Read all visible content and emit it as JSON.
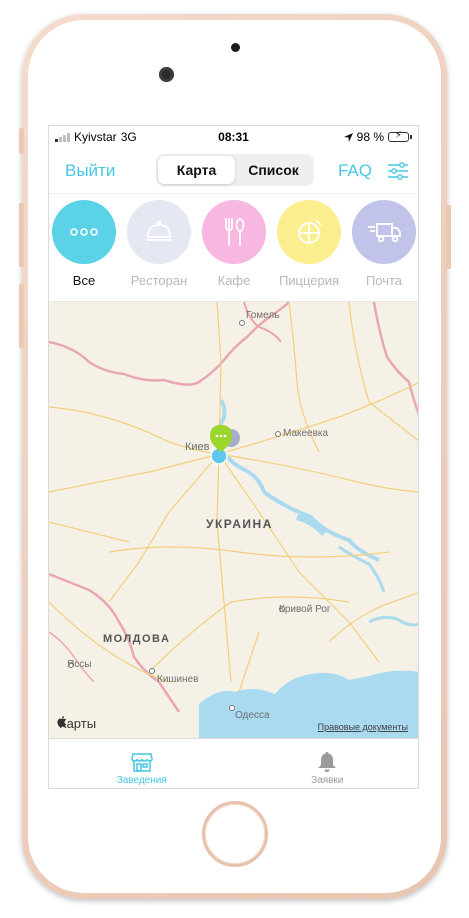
{
  "status_bar": {
    "carrier": "Kyivstar",
    "network": "3G",
    "time": "08:31",
    "battery": "98 %",
    "battery_level": 0.98
  },
  "navbar": {
    "logout_label": "Выйти",
    "segments": [
      {
        "label": "Карта",
        "active": true
      },
      {
        "label": "Список",
        "active": false
      }
    ],
    "faq_label": "FAQ",
    "filter_icon": "sliders-icon"
  },
  "categories": [
    {
      "label": "Все",
      "icon": "dots-icon",
      "color": "#5cd2e8",
      "active": true
    },
    {
      "label": "Ресторан",
      "icon": "cloche-icon",
      "color": "#e5e8f2",
      "active": false
    },
    {
      "label": "Кафе",
      "icon": "cutlery-icon",
      "color": "#f7b7e0",
      "active": false
    },
    {
      "label": "Пиццерия",
      "icon": "pizza-icon",
      "color": "#fbee8e",
      "active": false
    },
    {
      "label": "Почта",
      "icon": "delivery-truck-icon",
      "color": "#c1c4e8",
      "active": false
    }
  ],
  "map": {
    "labels": {
      "gomel": "Гомель",
      "kiev": "Киев",
      "makeevka": "Макеевка",
      "ukraine": "УКРАИНА",
      "krivoy_rog": "Кривой Рог",
      "moldova": "МОЛДОВА",
      "iasi": "Яссы",
      "chisinau": "Кишинев",
      "odessa": "Одесса"
    },
    "attribution": "Карты",
    "legal": "Правовые документы",
    "pins": [
      "pin-green",
      "pin-blue",
      "pin-gray"
    ]
  },
  "tabbar": [
    {
      "label": "Заведения",
      "icon": "store-icon",
      "active": true
    },
    {
      "label": "Заявки",
      "icon": "bell-icon",
      "active": false
    }
  ],
  "colors": {
    "accent": "#46c7e3",
    "frame": "#efd1bf"
  }
}
